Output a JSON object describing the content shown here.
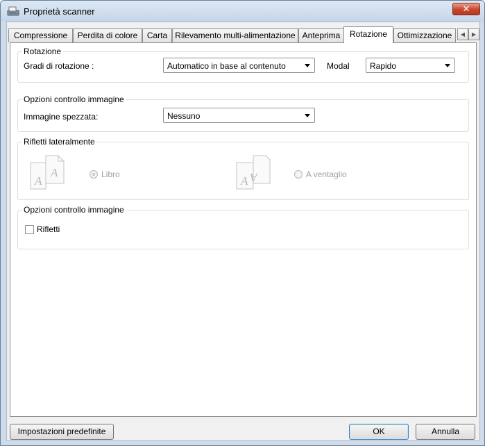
{
  "window": {
    "title": "Proprietà scanner",
    "close_symbol": "✕"
  },
  "tabs": [
    {
      "label": "Compressione",
      "active": false
    },
    {
      "label": "Perdita di colore",
      "active": false
    },
    {
      "label": "Carta",
      "active": false
    },
    {
      "label": "Rilevamento multi-alimentazione",
      "active": false
    },
    {
      "label": "Anteprima",
      "active": false
    },
    {
      "label": "Rotazione",
      "active": true
    },
    {
      "label": "Ottimizzazione",
      "active": false
    }
  ],
  "tab_scroll": {
    "left_icon": "◀",
    "right_icon": "▶"
  },
  "rotation_group": {
    "title": "Rotazione",
    "degrees_label": "Gradi di rotazione :",
    "degrees_value": "Automatico in base al contenuto",
    "modal_label": "Modal",
    "modal_value": "Rapido"
  },
  "image_control_group": {
    "title": "Opzioni controllo immagine",
    "split_label": "Immagine spezzata:",
    "split_value": "Nessuno"
  },
  "side_flip_group": {
    "title": "Rifletti lateralmente",
    "book_label": "Libro",
    "book_selected": true,
    "fan_label": "A ventaglio",
    "fan_selected": false,
    "enabled": false
  },
  "mirror_group": {
    "title": "Opzioni controllo immagine",
    "mirror_label": "Rifletti",
    "mirror_checked": false
  },
  "buttons": {
    "defaults": "Impostazioni predefinite",
    "ok": "OK",
    "cancel": "Annulla"
  }
}
